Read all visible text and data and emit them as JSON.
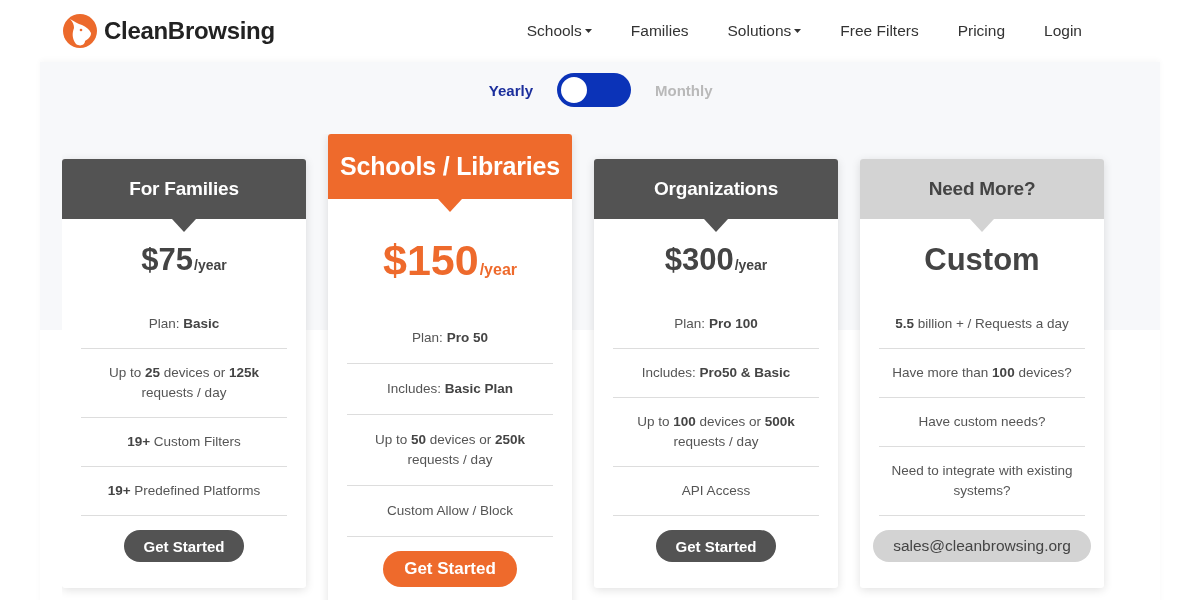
{
  "brand": {
    "name": "CleanBrowsing"
  },
  "nav": [
    {
      "label": "Schools",
      "dropdown": true
    },
    {
      "label": "Families",
      "dropdown": false
    },
    {
      "label": "Solutions",
      "dropdown": true
    },
    {
      "label": "Free Filters",
      "dropdown": false
    },
    {
      "label": "Pricing",
      "dropdown": false
    },
    {
      "label": "Login",
      "dropdown": false
    }
  ],
  "billing_toggle": {
    "on": false,
    "options": [
      {
        "label": "Yearly",
        "selected": true
      },
      {
        "label": "Monthly",
        "selected": false
      }
    ]
  },
  "plans": [
    {
      "kind": "dark",
      "title": "For Families",
      "amount": "$75",
      "period": "/year",
      "features": [
        "Plan: **Basic**",
        "Up to **25** devices or **125k** requests / day",
        "**19+** Custom Filters",
        "**19+** Predefined Platforms"
      ],
      "action": "Get Started"
    },
    {
      "kind": "featured",
      "title": "Schools / Libraries",
      "amount": "$150",
      "period": "/year",
      "features": [
        "Plan: **Pro 50**",
        "Includes: **Basic Plan**",
        "Up to **50** devices or **250k** requests / day",
        "Custom Allow / Block"
      ],
      "action": "Get Started"
    },
    {
      "kind": "dark",
      "title": "Organizations",
      "amount": "$300",
      "period": "/year",
      "features": [
        "Plan: **Pro 100**",
        "Includes: **Pro50 & Basic**",
        "Up to **100** devices or **500k** requests / day",
        "API Access"
      ],
      "action": "Get Started"
    },
    {
      "kind": "light",
      "title": "Need More?",
      "amount": "Custom",
      "features": [
        "**5.5** billion + / Requests a day",
        "Have more than **100** devices?",
        "Have custom needs?",
        "Need to integrate with existing systems?"
      ],
      "action": "sales@cleanbrowsing.org"
    }
  ]
}
